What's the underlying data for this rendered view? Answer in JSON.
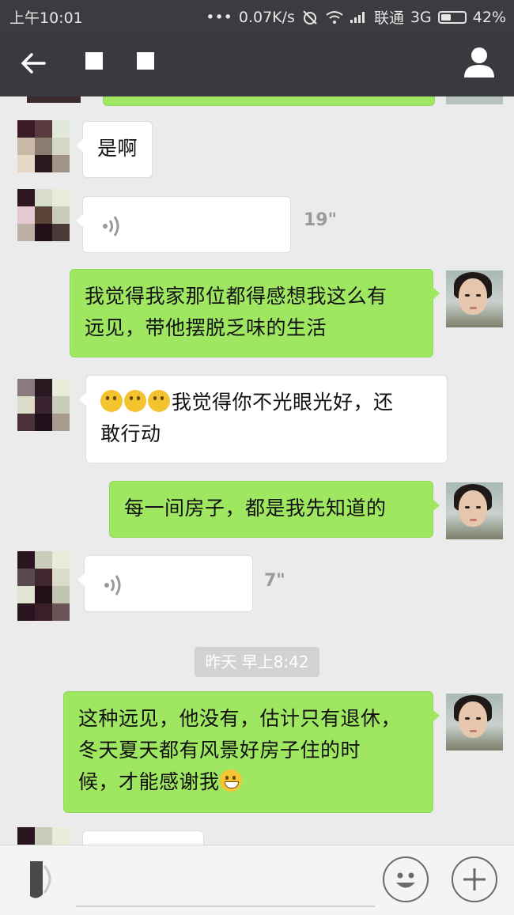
{
  "status_bar": {
    "time": "上午10:01",
    "dots": "•••",
    "network_speed": "0.07K/s",
    "carrier": "联通",
    "network_type": "3G",
    "battery": "42%",
    "battery_level": 0.42
  },
  "title_bar": {
    "icons": [
      "back-arrow-icon",
      "person-icon"
    ]
  },
  "messages": [
    {
      "side": "left",
      "text": "是啊"
    },
    {
      "side": "left",
      "type": "voice",
      "duration": "19\""
    },
    {
      "side": "right",
      "lines": [
        "我觉得我家那位都得感想我这么有",
        "远见，带他摆脱乏味的生活"
      ]
    },
    {
      "side": "left",
      "lines": [
        "我觉得你不光眼光好，还",
        "敢行动"
      ],
      "emoji_count": 3
    },
    {
      "side": "right",
      "text": "每一间房子，都是我先知道的"
    },
    {
      "side": "left",
      "type": "voice",
      "duration": "7\""
    },
    {
      "side": "right",
      "lines": [
        "这种远见，他没有，估计只有退休，",
        "冬天夏天都有风景好房子住的时",
        "候，才能感谢我"
      ],
      "emoji": "grin"
    }
  ],
  "timestamp": "昨天 早上8:42",
  "colors": {
    "bubble_green": "#9fe761",
    "bubble_white": "#ffffff",
    "chat_bg": "#ebebeb",
    "titlebar_bg": "#393a3f"
  },
  "input_bar": {
    "placeholder": "",
    "icons": [
      "voice-toggle-icon",
      "emoji-button-icon",
      "plus-button-icon"
    ]
  }
}
